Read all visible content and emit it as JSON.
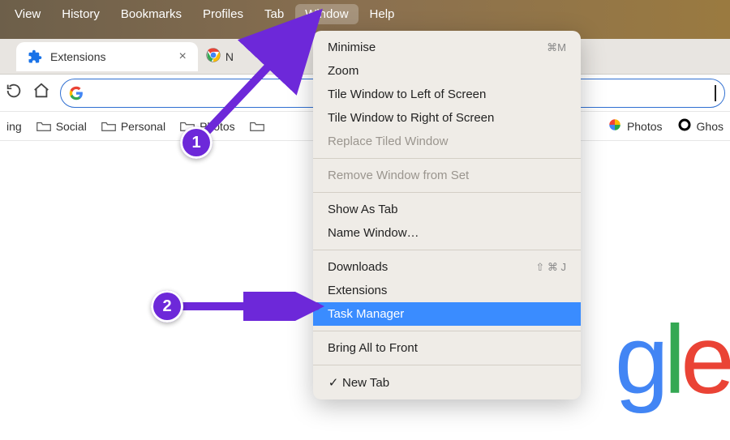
{
  "menubar": {
    "items": [
      "View",
      "History",
      "Bookmarks",
      "Profiles",
      "Tab",
      "Window",
      "Help"
    ],
    "active_index": 5
  },
  "tabs": {
    "tab1": {
      "label": "Extensions"
    },
    "tab2": {
      "label": "N"
    }
  },
  "omnibox": {
    "value": ""
  },
  "bookmarks": {
    "left": [
      {
        "label": "ing"
      },
      {
        "label": "Social"
      },
      {
        "label": "Personal"
      },
      {
        "label": "Photos"
      }
    ],
    "right": [
      {
        "label": "Photos",
        "icon": "google-photos"
      },
      {
        "label": "Ghos",
        "icon": "ghostery"
      }
    ]
  },
  "dropdown": {
    "groups": [
      [
        {
          "label": "Minimise",
          "shortcut": "⌘M"
        },
        {
          "label": "Zoom"
        },
        {
          "label": "Tile Window to Left of Screen"
        },
        {
          "label": "Tile Window to Right of Screen"
        },
        {
          "label": "Replace Tiled Window",
          "disabled": true
        }
      ],
      [
        {
          "label": "Remove Window from Set",
          "disabled": true
        }
      ],
      [
        {
          "label": "Show As Tab"
        },
        {
          "label": "Name Window…"
        }
      ],
      [
        {
          "label": "Downloads",
          "shortcut": "⇧ ⌘ J"
        },
        {
          "label": "Extensions"
        },
        {
          "label": "Task Manager",
          "highlight": true
        }
      ],
      [
        {
          "label": "Bring All to Front"
        }
      ],
      [
        {
          "label": "New Tab",
          "checked": true
        }
      ]
    ]
  },
  "annotations": {
    "step1": "1",
    "step2": "2"
  },
  "logo": {
    "g1": "g",
    "l": "l",
    "e": "e"
  }
}
